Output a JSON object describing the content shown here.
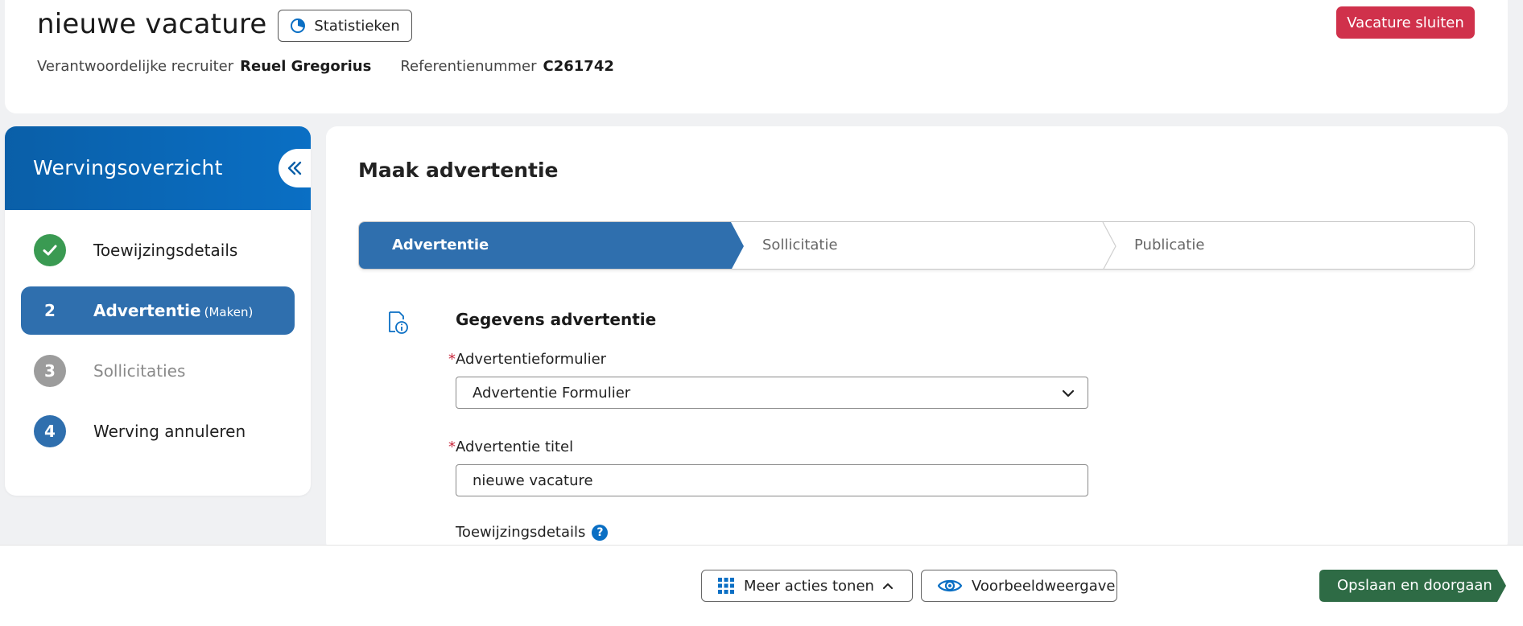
{
  "header": {
    "title": "nieuwe vacature",
    "stats_button": "Statistieken",
    "close_button": "Vacature sluiten",
    "recruiter_label": "Verantwoordelijke recruiter",
    "recruiter_name": "Reuel Gregorius",
    "reference_label": "Referentienummer",
    "reference_value": "C261742"
  },
  "sidebar": {
    "title": "Wervingsoverzicht",
    "steps": [
      {
        "number": "✓",
        "label": "Toewijzingsdetails",
        "status": "done"
      },
      {
        "number": "2",
        "label": "Advertentie",
        "sub": "(Maken)",
        "status": "active"
      },
      {
        "number": "3",
        "label": "Sollicitaties",
        "status": "disabled"
      },
      {
        "number": "4",
        "label": "Werving annuleren",
        "status": "pending"
      }
    ]
  },
  "main": {
    "title": "Maak advertentie",
    "stepper": [
      "Advertentie",
      "Sollicitatie",
      "Publicatie"
    ],
    "section_title": "Gegevens advertentie",
    "form_label": "Advertentieformulier",
    "form_value": "Advertentie Formulier",
    "title_label": "Advertentie titel",
    "title_value": "nieuwe vacature",
    "required_mark": "*",
    "assignment_label": "Toewijzingsdetails",
    "help_glyph": "?"
  },
  "footer": {
    "more_actions": "Meer acties tonen",
    "preview": "Voorbeeldweergave",
    "save": "Opslaan en doorgaan"
  },
  "colors": {
    "primary": "#2f6fae",
    "danger": "#d0314b",
    "success": "#2e6b45",
    "done_green": "#3a9a52"
  }
}
